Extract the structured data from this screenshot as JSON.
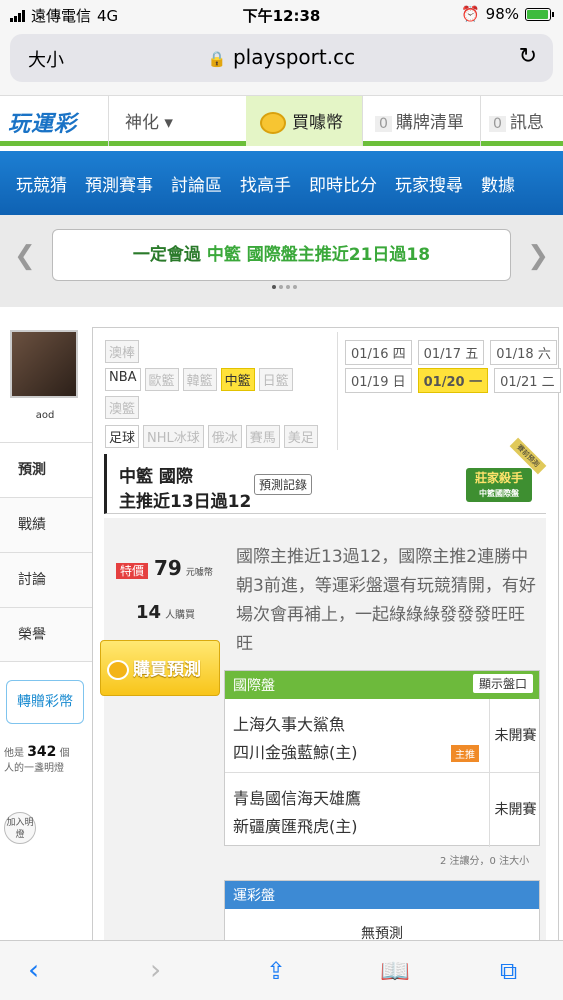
{
  "status_bar": {
    "carrier": "遠傳電信",
    "network": "4G",
    "time": "下午12:38",
    "battery": "98%"
  },
  "url_bar": {
    "text_size": "大小",
    "domain": "playsport.cc"
  },
  "header": {
    "logo": "玩運彩",
    "user": "神化 ▾",
    "buy_coin": "買噱幣",
    "list_count": "0",
    "list_label": "購牌清單",
    "msg_count": "0",
    "msg_label": "訊息"
  },
  "nav": [
    "玩競猜",
    "預測賽事",
    "討論區",
    "找高手",
    "即時比分",
    "玩家搜尋",
    "數據"
  ],
  "banner": {
    "prefix": "一定會過",
    "league": "中籃",
    "rest": "國際盤主推近21日過18"
  },
  "sidebar": {
    "username": "aod",
    "items": [
      "預測",
      "戰績",
      "討論",
      "榮譽"
    ],
    "gift": "轉贈彩幣",
    "bulb_prefix": "他是",
    "bulb_count": "342",
    "bulb_unit": "個",
    "bulb_suffix": "人的一盞明燈",
    "join": "加入明燈"
  },
  "leagues": {
    "row1": [
      "澳棒"
    ],
    "row2": [
      "NBA",
      "歐籃",
      "韓籃",
      "中籃",
      "日籃"
    ],
    "row3": [
      "澳籃"
    ],
    "row4": [
      "足球",
      "NHL冰球",
      "俄冰",
      "賽馬",
      "美足"
    ]
  },
  "dates": {
    "row1": [
      "01/16 四",
      "01/17 五",
      "01/18 六"
    ],
    "row2": [
      "01/19 日",
      "01/20 一",
      "01/21 二"
    ]
  },
  "title": {
    "line1": "中籃 國際",
    "line2": "主推近13日過12",
    "record_btn": "預測記錄",
    "badge": "莊家殺手",
    "badge_sub": "中籃國際盤",
    "ribbon": "賽前預測"
  },
  "price": {
    "tag": "特價",
    "amount": "79",
    "unit": "元噱幣"
  },
  "buyers": {
    "count": "14",
    "unit": "人購買"
  },
  "buy_button": "購買預測",
  "description": "國際主推近13過12，國際主推2連勝中朝3前進，等運彩盤還有玩競猜開，有好場次會再補上，一起綠綠綠發發發旺旺旺",
  "guoji": {
    "header": "國際盤",
    "show_button": "顯示盤口",
    "matches": [
      {
        "away": "上海久事大鯊魚",
        "home": "四川金強藍鯨(主)",
        "status": "未開賽",
        "tag": "主推"
      },
      {
        "away": "青島國信海天雄鷹",
        "home": "新疆廣匯飛虎(主)",
        "status": "未開賽",
        "tag": ""
      }
    ],
    "note": "2 注讓分，0 注大小"
  },
  "yuncai": {
    "header": "運彩盤",
    "empty": "無預測"
  },
  "colors": {
    "green": "#6dba3c",
    "blue_nav": "#1d7fd3",
    "yellow": "#ffe23a",
    "orange": "#f08a28"
  }
}
